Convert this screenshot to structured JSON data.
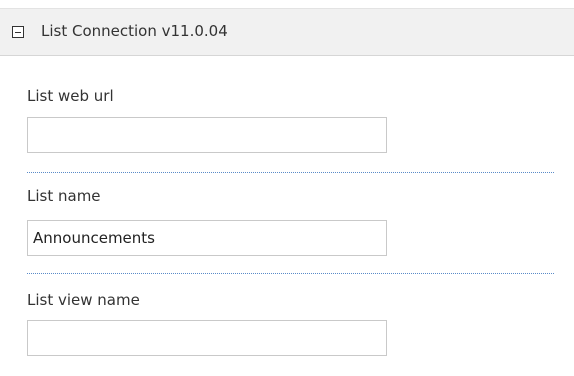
{
  "header": {
    "title": "List Connection v11.0.04",
    "collapse_icon": "minus-box-icon"
  },
  "fields": [
    {
      "label": "List web url",
      "value": ""
    },
    {
      "label": "List name",
      "value": "Announcements"
    },
    {
      "label": "List view name",
      "value": ""
    }
  ],
  "colors": {
    "header_bg": "#f1f1f1",
    "divider": "#5a8bc8",
    "input_border": "#c9c9c9"
  }
}
